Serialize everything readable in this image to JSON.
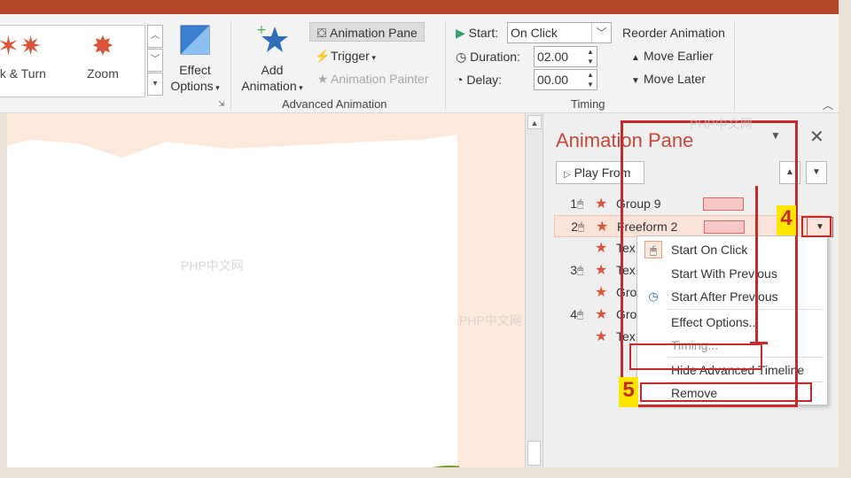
{
  "ribbon": {
    "gallery": [
      {
        "label": "nk & Turn",
        "icon": "spin-star-icon"
      },
      {
        "label": "Zoom",
        "icon": "zoom-star-icon"
      }
    ],
    "effect_options": "Effect\nOptions",
    "effect_options_line1": "Effect",
    "effect_options_line2": "Options",
    "add_animation_line1": "Add",
    "add_animation_line2": "Animation",
    "animation_pane": "Animation Pane",
    "trigger": "Trigger",
    "animation_painter": "Animation Painter",
    "advanced_animation": "Advanced Animation",
    "timing": {
      "start_label": "Start:",
      "start_value": "On Click",
      "duration_label": "Duration:",
      "duration_value": "02.00",
      "delay_label": "Delay:",
      "delay_value": "00.00",
      "group_label": "Timing"
    },
    "reorder": {
      "title": "Reorder Animation",
      "earlier": "Move Earlier",
      "later": "Move Later"
    }
  },
  "pane": {
    "title": "Animation Pane",
    "play_from": "Play From",
    "rows": [
      {
        "num": "1",
        "name": "Group 9",
        "bar": true,
        "selected": false
      },
      {
        "num": "2",
        "name": "Freeform 2",
        "bar": true,
        "selected": true
      },
      {
        "num": "",
        "name": "Tex",
        "bar": false,
        "selected": false
      },
      {
        "num": "3",
        "name": "Tex",
        "bar": false,
        "selected": false
      },
      {
        "num": "",
        "name": "Gro",
        "bar": false,
        "selected": false
      },
      {
        "num": "4",
        "name": "Gro",
        "bar": false,
        "selected": false
      },
      {
        "num": "",
        "name": "Tex",
        "bar": false,
        "selected": false
      }
    ]
  },
  "context_menu": {
    "items": [
      {
        "label": "Start On Click",
        "icon": "mouse-icon"
      },
      {
        "label": "Start With Previous",
        "icon": ""
      },
      {
        "label": "Start After Previous",
        "icon": "clock-icon"
      },
      {
        "label": "Effect Options...",
        "icon": ""
      },
      {
        "label": "Timing...",
        "icon": ""
      },
      {
        "label": "Hide Advanced Timeline",
        "icon": ""
      },
      {
        "label": "Remove",
        "icon": ""
      }
    ]
  },
  "annotations": {
    "step4": "4",
    "step5": "5"
  },
  "watermarks": {
    "a": "PHP中文网",
    "b": "PHP中文网",
    "c": "PHP中文网"
  },
  "colors": {
    "accent": "#c9473a",
    "annotation": "#c42b2b",
    "badge": "#ffe600",
    "slide_bg": "#fde9dc"
  }
}
